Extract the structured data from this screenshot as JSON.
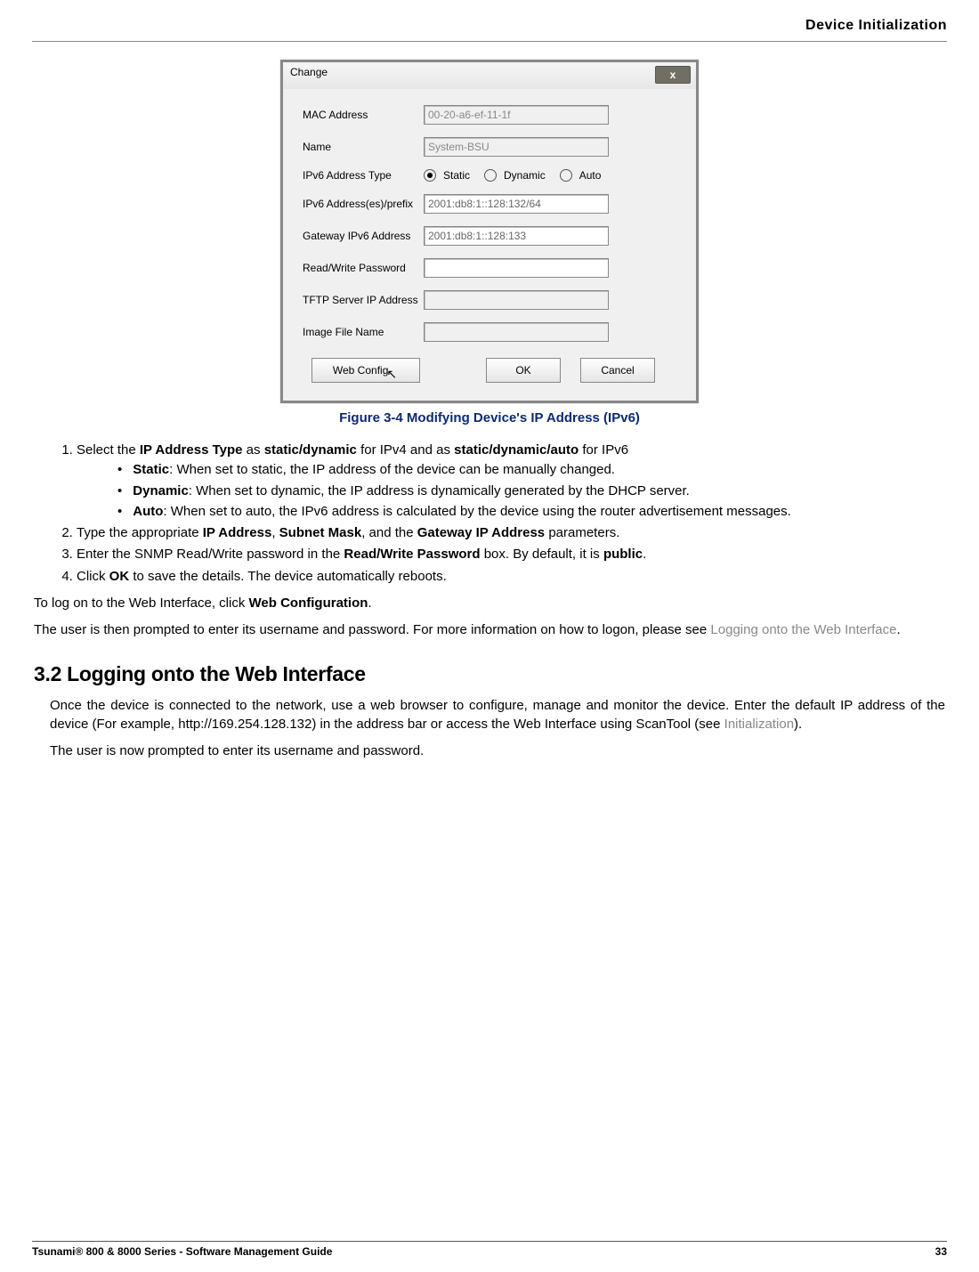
{
  "header": {
    "title": "Device Initialization"
  },
  "dialog": {
    "title": "Change",
    "close_alt": "x",
    "labels": {
      "mac": "MAC Address",
      "name": "Name",
      "addr_type": "IPv6  Address Type",
      "addr_prefix": "IPv6 Address(es)/prefix",
      "gateway": "Gateway IPv6 Address",
      "rw_pass": "Read/Write Password",
      "tftp": "TFTP Server IP Address",
      "img": "Image File Name"
    },
    "values": {
      "mac": "00-20-a6-ef-11-1f",
      "name": "System-BSU",
      "addr_prefix": "2001:db8:1::128:132/64",
      "gateway": "2001:db8:1::128:133",
      "rw_pass": "",
      "tftp": "",
      "img": ""
    },
    "radios": {
      "static": "Static",
      "dynamic": "Dynamic",
      "auto": "Auto"
    },
    "buttons": {
      "web": "Web Config",
      "ok": "OK",
      "cancel": "Cancel"
    }
  },
  "figure_caption": "Figure 3-4 Modifying Device's IP Address (IPv6)",
  "steps": {
    "s1_pre": "Select the ",
    "s1_b1": "IP Address Type",
    "s1_mid": " as ",
    "s1_b2": "static/dynamic",
    "s1_mid2": " for IPv4 and as ",
    "s1_b3": "static/dynamic/auto",
    "s1_end": " for IPv6",
    "bullet_static_label": "Static",
    "bullet_static_text": ": When set to static, the IP address of the device can be manually changed.",
    "bullet_dynamic_label": "Dynamic",
    "bullet_dynamic_text": ": When set to dynamic, the IP address is dynamically generated by the DHCP server.",
    "bullet_auto_label": "Auto",
    "bullet_auto_text": ": When set to auto, the IPv6 address is calculated by the device using the router advertisement messages.",
    "s2_pre": "Type the appropriate ",
    "s2_b1": "IP Address",
    "s2_mid1": ", ",
    "s2_b2": "Subnet Mask",
    "s2_mid2": ", and the ",
    "s2_b3": "Gateway IP Address",
    "s2_end": " parameters.",
    "s3_pre": "Enter the SNMP Read/Write password in the ",
    "s3_b1": "Read/Write Password",
    "s3_mid": " box. By default, it is ",
    "s3_b2": "public",
    "s3_end": ".",
    "s4_pre": "Click ",
    "s4_b1": "OK",
    "s4_end": " to save the details. The device automatically reboots."
  },
  "para_weblog_pre": "To log on to the Web Interface, click ",
  "para_weblog_bold": "Web Configuration",
  "para_weblog_end": ".",
  "para_prompt_pre": "The user is then prompted to enter its username and password. For more information on how to logon, please see ",
  "para_prompt_link": "Logging onto the Web Interface",
  "para_prompt_end": ".",
  "heading_32": "3.2 Logging onto the Web Interface",
  "sec32_p1_pre": "Once the device is connected to the network, use a web browser to configure, manage and monitor the device. Enter the default IP address of the device (For example, http://169.254.128.132) in the address bar or access the Web Interface using ScanTool (see ",
  "sec32_p1_link": "Initialization",
  "sec32_p1_end": ").",
  "sec32_p2": "The user is now prompted to enter its username and password.",
  "footer": {
    "left": "Tsunami® 800 & 8000 Series - Software Management Guide",
    "right": "33"
  }
}
